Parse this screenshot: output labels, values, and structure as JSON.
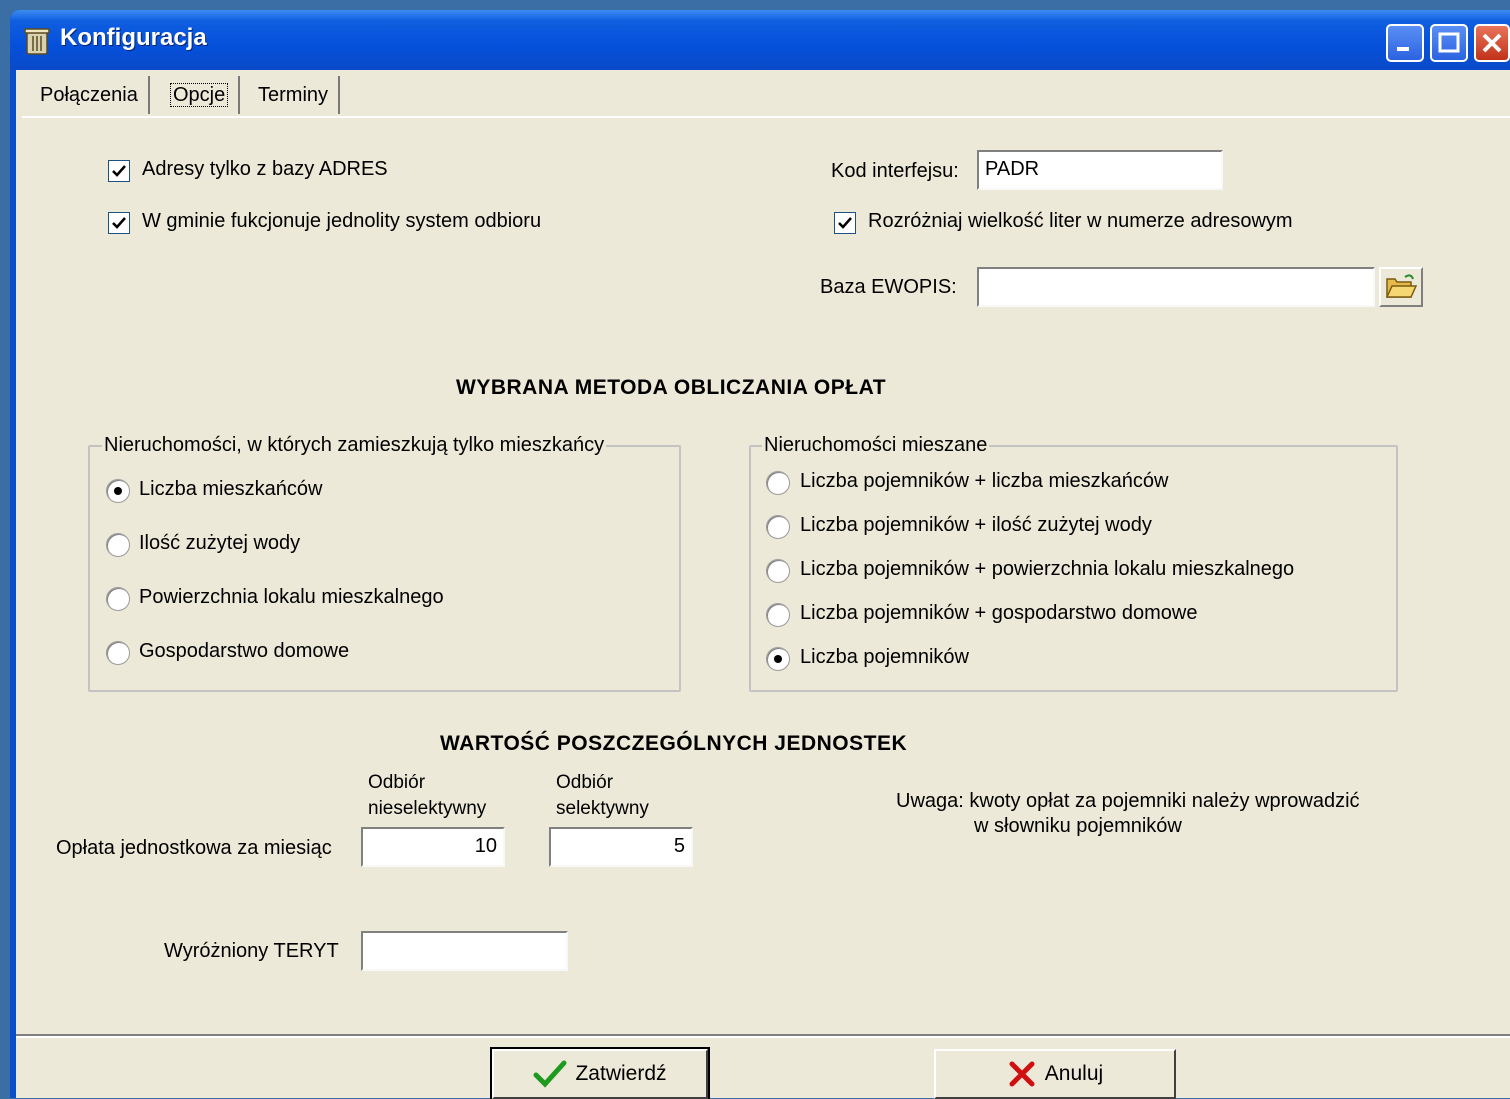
{
  "window": {
    "title": "Konfiguracja"
  },
  "tabs": [
    {
      "label": "Połączenia"
    },
    {
      "label": "Opcje"
    },
    {
      "label": "Terminy"
    }
  ],
  "options": {
    "adresy_checkbox": {
      "label": "Adresy tylko z bazy ADRES",
      "checked": true
    },
    "gmina_checkbox": {
      "label": "W gminie fukcjonuje jednolity system odbioru",
      "checked": true
    },
    "kod_interfejsu": {
      "label": "Kod interfejsu:",
      "value": "PADR"
    },
    "rozrozniaj_checkbox": {
      "label": "Rozróżniaj wielkość liter w numerze adresowym",
      "checked": true
    },
    "baza_ewopis": {
      "label": "Baza EWOPIS:",
      "value": ""
    }
  },
  "method_section": {
    "heading": "WYBRANA METODA OBLICZANIA OPŁAT",
    "residents_group": {
      "title": "Nieruchomości, w których zamieszkują tylko mieszkańcy",
      "options": [
        {
          "label": "Liczba mieszkańców",
          "selected": true
        },
        {
          "label": "Ilość zużytej wody",
          "selected": false
        },
        {
          "label": "Powierzchnia lokalu mieszkalnego",
          "selected": false
        },
        {
          "label": "Gospodarstwo domowe",
          "selected": false
        }
      ]
    },
    "mixed_group": {
      "title": "Nieruchomości mieszane",
      "options": [
        {
          "label": "Liczba pojemników + liczba mieszkańców",
          "selected": false
        },
        {
          "label": "Liczba pojemników + ilość zużytej wody",
          "selected": false
        },
        {
          "label": "Liczba pojemników + powierzchnia lokalu mieszkalnego",
          "selected": false
        },
        {
          "label": "Liczba pojemników + gospodarstwo domowe",
          "selected": false
        },
        {
          "label": "Liczba pojemników",
          "selected": true
        }
      ]
    }
  },
  "units_section": {
    "heading": "WARTOŚĆ POSZCZEGÓLNYCH JEDNOSTEK",
    "col_nonselective": [
      "Odbiór",
      "nieselektywny"
    ],
    "col_selective": [
      "Odbiór",
      "selektywny"
    ],
    "row_label": "Opłata jednostkowa za miesiąc",
    "nonselective_value": "10",
    "selective_value": "5",
    "note_line1": "Uwaga: kwoty opłat za pojemniki należy wprowadzić",
    "note_line2": "w słowniku pojemników",
    "teryt_label": "Wyróżniony TERYT",
    "teryt_value": ""
  },
  "buttons": {
    "confirm": "Zatwierdź",
    "cancel": "Anuluj"
  },
  "colors": {
    "titlebar": "#0550db",
    "dialog_bg": "#ece9d8",
    "confirm_icon": "#1e9a1e",
    "cancel_icon": "#d01010"
  },
  "icons": {
    "app": "trash-bin-icon",
    "browse": "open-folder-icon",
    "confirm": "checkmark-icon",
    "cancel": "x-mark-icon"
  }
}
